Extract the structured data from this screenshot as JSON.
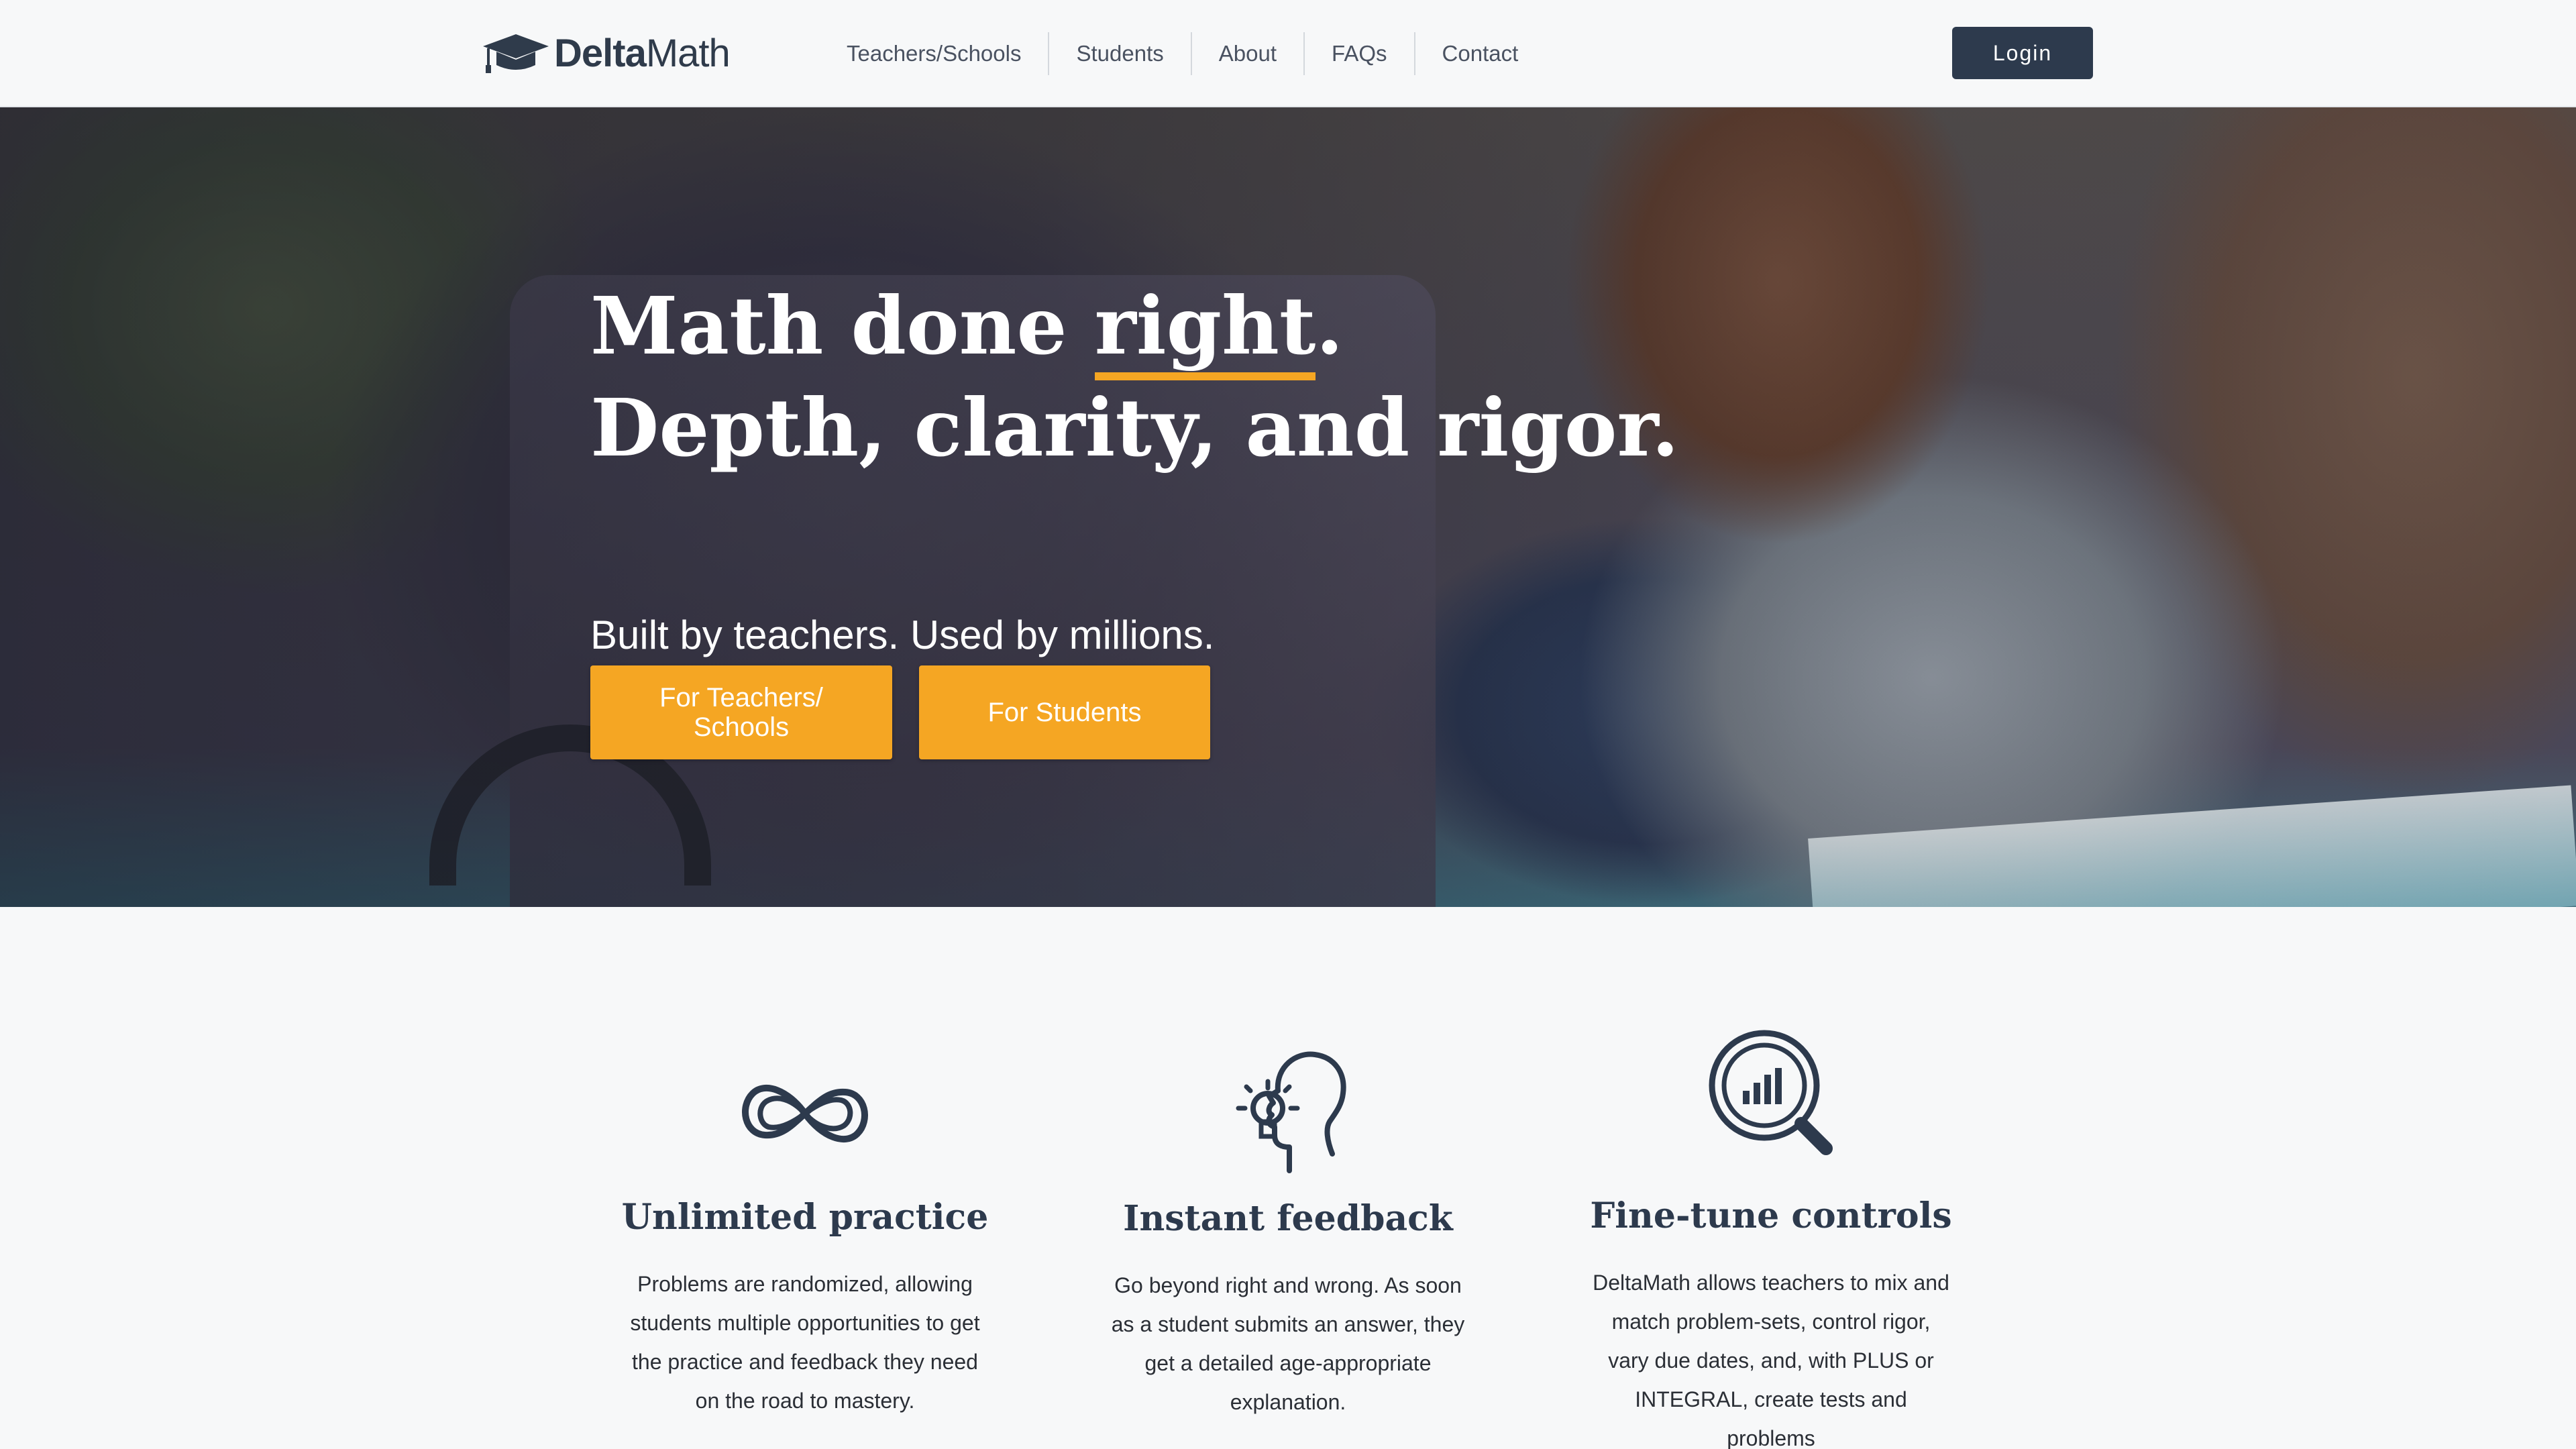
{
  "header": {
    "logo": {
      "bold": "Delta",
      "regular": "Math"
    },
    "nav": [
      "Teachers/Schools",
      "Students",
      "About",
      "FAQs",
      "Contact"
    ],
    "login_label": "Login"
  },
  "hero": {
    "title_line1_start": "Math done ",
    "title_line1_emph": "right",
    "title_line1_end": ".",
    "title_line2": "Depth, clarity, and rigor.",
    "subtitle": "Built by teachers. Used by millions.",
    "btn_teachers_line1": "For Teachers/",
    "btn_teachers_line2": "Schools",
    "btn_students": "For Students",
    "accent_color": "#f5a623"
  },
  "features": [
    {
      "icon": "infinity-icon",
      "title": "Unlimited practice",
      "description": "Problems are randomized, allowing students multiple opportunities to get the practice and feedback they need on the road to mastery."
    },
    {
      "icon": "lightbulb-head-icon",
      "title": "Instant feedback",
      "description": "Go beyond right and wrong. As soon as a student submits an answer, they get a detailed age-appropriate explanation."
    },
    {
      "icon": "magnifier-chart-icon",
      "title": "Fine-tune controls",
      "description": "DeltaMath allows teachers to mix and match problem-sets, control rigor, vary due dates, and, with PLUS or INTEGRAL, create tests and problems"
    }
  ]
}
